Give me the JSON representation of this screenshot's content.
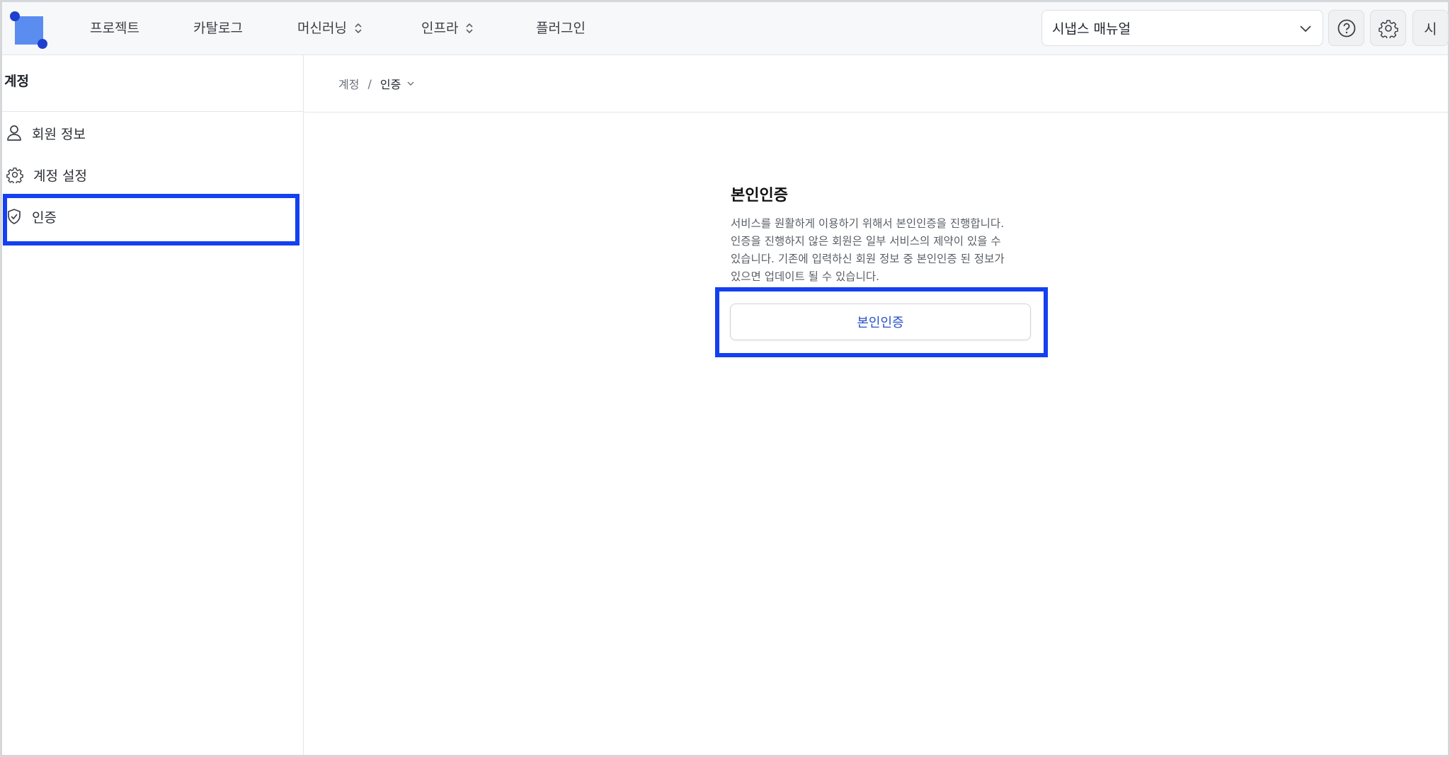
{
  "nav": {
    "items": [
      {
        "label": "프로젝트",
        "has_toggle": false
      },
      {
        "label": "카탈로그",
        "has_toggle": false
      },
      {
        "label": "머신러닝",
        "has_toggle": true
      },
      {
        "label": "인프라",
        "has_toggle": true
      },
      {
        "label": "플러그인",
        "has_toggle": false
      }
    ],
    "manual_select_value": "시냅스 매뉴얼",
    "avatar_initial": "시"
  },
  "sidebar": {
    "title": "계정",
    "items": [
      {
        "label": "회원 정보",
        "icon": "user-icon"
      },
      {
        "label": "계정 설정",
        "icon": "gear-icon"
      },
      {
        "label": "인증",
        "icon": "shield-check-icon",
        "selected": true
      }
    ]
  },
  "breadcrumb": {
    "parent": "계정",
    "separator": "/",
    "current": "인증"
  },
  "main": {
    "title": "본인인증",
    "description_lines": [
      "서비스를 원활하게 이용하기 위해서 본인인증을 진행합니다.",
      "인증을 진행하지 않은 회원은 일부 서비스의 제약이 있을 수",
      "있습니다. 기존에 입력하신 회원 정보 중 본인인증 된 정보가",
      "있으면 업데이트 될 수 있습니다."
    ],
    "button_label": "본인인증"
  },
  "colors": {
    "highlight": "#1340f0",
    "logo_square": "#5b8df0",
    "logo_dot": "#1f3fcf",
    "link_blue": "#2550c8"
  }
}
